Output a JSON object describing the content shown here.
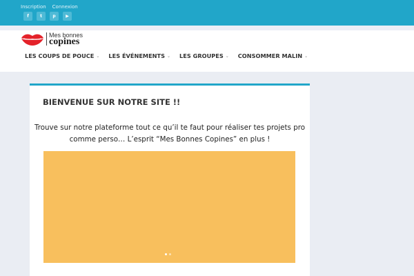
{
  "topbar": {
    "links": [
      "Inscription",
      "Connexion"
    ],
    "socials": [
      {
        "icon": "facebook-icon",
        "glyph": "f"
      },
      {
        "icon": "twitter-icon",
        "glyph": "t"
      },
      {
        "icon": "pinterest-icon",
        "glyph": "p"
      },
      {
        "icon": "youtube-icon",
        "glyph": "▶"
      }
    ],
    "color": "#21a6c9"
  },
  "logo": {
    "small": "Mes bonnes",
    "big": "copines",
    "lips_color": "#e4222a"
  },
  "nav": {
    "items": [
      {
        "label": "LES COUPS DE POUCE",
        "name": "nav-item-coups-de-pouce"
      },
      {
        "label": "LES ÉVÉNEMENTS",
        "name": "nav-item-evenements"
      },
      {
        "label": "LES GROUPES",
        "name": "nav-item-groupes"
      },
      {
        "label": "CONSOMMER MALIN",
        "name": "nav-item-consommer-malin"
      }
    ],
    "chevron": "⌄"
  },
  "main": {
    "title": "BIENVENUE SUR NOTRE SITE !!",
    "text_line1": "Trouve sur notre plateforme tout ce qu’il te faut pour réaliser tes projets pro",
    "text_line2": "comme perso… L’esprit “Mes Bonnes Copines” en plus !",
    "slider": {
      "color": "#f8bf5d",
      "slide_count": 2,
      "active_index": 0
    }
  }
}
